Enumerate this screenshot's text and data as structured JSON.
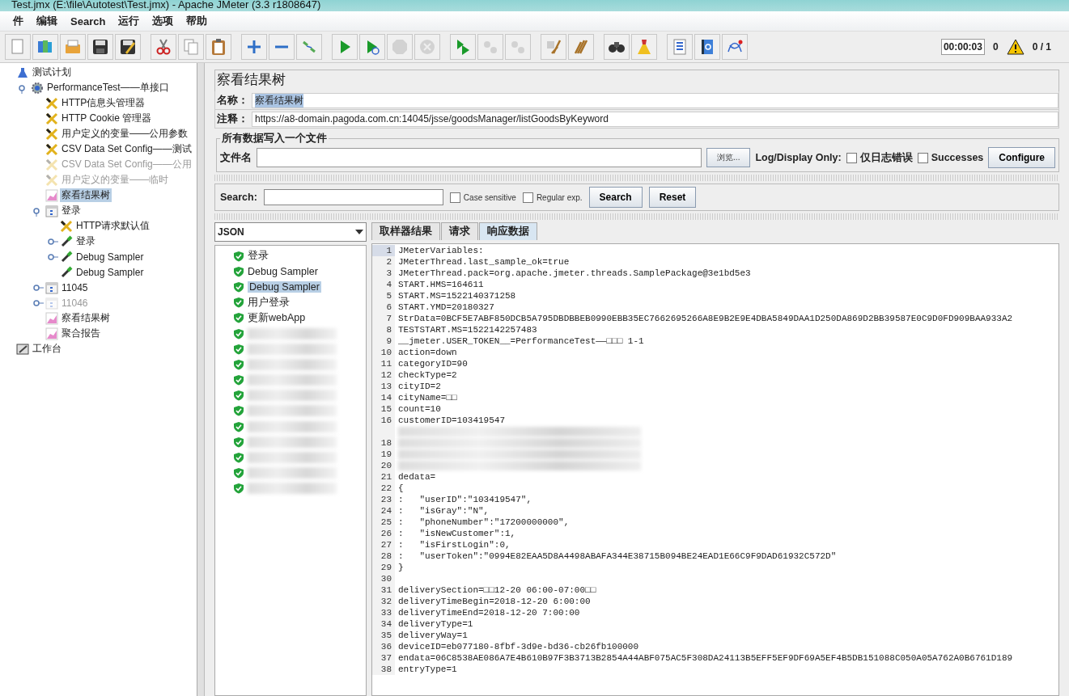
{
  "window": {
    "title": "Test.jmx (E:\\file\\Autotest\\Test.jmx) - Apache JMeter (3.3 r1808647)"
  },
  "menu": [
    "件",
    "编辑",
    "Search",
    "运行",
    "选项",
    "帮助"
  ],
  "toolbar": [
    {
      "kind": "new",
      "disabled": false
    },
    {
      "kind": "templates",
      "disabled": false
    },
    {
      "kind": "open",
      "disabled": false
    },
    {
      "kind": "save",
      "disabled": false
    },
    {
      "kind": "saveas",
      "disabled": false
    },
    {
      "kind": "sep"
    },
    {
      "kind": "cut",
      "disabled": false
    },
    {
      "kind": "copy",
      "disabled": false
    },
    {
      "kind": "paste",
      "disabled": false
    },
    {
      "kind": "sep"
    },
    {
      "kind": "expand",
      "disabled": false
    },
    {
      "kind": "collapse",
      "disabled": false
    },
    {
      "kind": "toggle",
      "disabled": false
    },
    {
      "kind": "sep"
    },
    {
      "kind": "start",
      "disabled": false
    },
    {
      "kind": "startnopause",
      "disabled": false
    },
    {
      "kind": "stop",
      "disabled": true
    },
    {
      "kind": "shutdown",
      "disabled": true
    },
    {
      "kind": "sep"
    },
    {
      "kind": "remotestart",
      "disabled": false
    },
    {
      "kind": "remotestop",
      "disabled": true
    },
    {
      "kind": "remoteshutdown",
      "disabled": true
    },
    {
      "kind": "sep"
    },
    {
      "kind": "clear",
      "disabled": false
    },
    {
      "kind": "clearall",
      "disabled": false
    },
    {
      "kind": "sep"
    },
    {
      "kind": "search",
      "disabled": false
    },
    {
      "kind": "reset",
      "disabled": false
    },
    {
      "kind": "sep"
    },
    {
      "kind": "functions",
      "disabled": false
    },
    {
      "kind": "help",
      "disabled": false
    },
    {
      "kind": "logger",
      "disabled": false
    }
  ],
  "status": {
    "timer": "00:00:03",
    "warnings": "0",
    "threads": "0 / 1"
  },
  "tree": [
    {
      "label": "测试计划",
      "kind": "plan",
      "selected": false,
      "disabled": false,
      "children": [
        {
          "label": "PerformanceTest——单接口",
          "kind": "threadgroup",
          "selected": false,
          "disabled": false,
          "expanded": true,
          "children": [
            {
              "label": "HTTP信息头管理器",
              "kind": "config",
              "selected": false,
              "disabled": false
            },
            {
              "label": "HTTP Cookie 管理器",
              "kind": "config",
              "selected": false,
              "disabled": false
            },
            {
              "label": "用户定义的变量——公用参数",
              "kind": "config",
              "selected": false,
              "disabled": false
            },
            {
              "label": "CSV Data Set Config——测试",
              "kind": "config",
              "selected": false,
              "disabled": false
            },
            {
              "label": "CSV Data Set Config——公用",
              "kind": "config",
              "selected": false,
              "disabled": true
            },
            {
              "label": "用户定义的变量——临时",
              "kind": "config",
              "selected": false,
              "disabled": true
            },
            {
              "label": "察看结果树",
              "kind": "listener",
              "selected": true,
              "disabled": false
            },
            {
              "label": "登录",
              "kind": "controller",
              "selected": false,
              "disabled": false,
              "expanded": true,
              "children": [
                {
                  "label": "HTTP请求默认值",
                  "kind": "config",
                  "selected": false,
                  "disabled": false
                },
                {
                  "label": "登录",
                  "kind": "sampler",
                  "selected": false,
                  "disabled": false,
                  "expanded": false
                },
                {
                  "label": "Debug Sampler",
                  "kind": "sampler",
                  "selected": false,
                  "disabled": false,
                  "expanded": false
                },
                {
                  "label": "Debug Sampler",
                  "kind": "sampler",
                  "selected": false,
                  "disabled": false
                }
              ]
            },
            {
              "label": "11045",
              "kind": "controller",
              "selected": false,
              "disabled": false,
              "expanded": false
            },
            {
              "label": "11046",
              "kind": "controller",
              "selected": false,
              "disabled": true,
              "expanded": false
            },
            {
              "label": "察看结果树",
              "kind": "listener",
              "selected": false,
              "disabled": false
            },
            {
              "label": "聚合报告",
              "kind": "listener",
              "selected": false,
              "disabled": false
            }
          ]
        }
      ]
    },
    {
      "label": "工作台",
      "kind": "workbench",
      "selected": false,
      "disabled": false
    }
  ],
  "panel": {
    "title": "察看结果树",
    "name_label": "名称：",
    "name_value": "察看结果树",
    "comment_label": "注释：",
    "comment_value": "https://a8-domain.pagoda.com.cn:14045/jsse/goodsManager/listGoodsByKeyword",
    "file_group": "所有数据写入一个文件",
    "file_label": "文件名",
    "browse": "浏览...",
    "log_label": "Log/Display Only:",
    "log_options": [
      {
        "label": "仅日志错误",
        "checked": false
      },
      {
        "label": "Successes",
        "checked": false
      }
    ],
    "configure": "Configure"
  },
  "search": {
    "label": "Search:",
    "options": [
      {
        "label": "Case sensitive",
        "checked": false
      },
      {
        "label": "Regular exp.",
        "checked": false
      }
    ],
    "buttons": [
      "Search",
      "Reset"
    ]
  },
  "renderer": "JSON",
  "results": [
    {
      "label": "登录",
      "selected": false
    },
    {
      "label": "Debug Sampler",
      "selected": false
    },
    {
      "label": "Debug Sampler",
      "selected": true
    },
    {
      "label": "用户登录",
      "selected": false
    },
    {
      "label": "更新webApp",
      "selected": false
    },
    {
      "kind": "blurred"
    },
    {
      "kind": "blurred"
    },
    {
      "kind": "blurred"
    },
    {
      "kind": "blurred"
    },
    {
      "kind": "blurred"
    },
    {
      "kind": "blurred"
    },
    {
      "kind": "blurred"
    },
    {
      "kind": "blurred"
    },
    {
      "kind": "blurred"
    },
    {
      "kind": "blurred"
    },
    {
      "kind": "blurred"
    }
  ],
  "tabs": [
    {
      "label": "取样器结果",
      "selected": false
    },
    {
      "label": "请求",
      "selected": false
    },
    {
      "label": "响应数据",
      "selected": true
    }
  ],
  "code": [
    {
      "num": "1",
      "text": "JMeterVariables:"
    },
    {
      "num": "2",
      "text": "JMeterThread.last_sample_ok=true"
    },
    {
      "num": "3",
      "text": "JMeterThread.pack=org.apache.jmeter.threads.SamplePackage@3e1bd5e3"
    },
    {
      "num": "4",
      "text": "START.HMS=164611"
    },
    {
      "num": "5",
      "text": "START.MS=1522140371258"
    },
    {
      "num": "6",
      "text": "START.YMD=20180327"
    },
    {
      "num": "7",
      "text": "StrData=0BCF5E7ABF850DCB5A795DBDBBEB0990EBB35EC7662695266A8E9B2E9E4DBA5849DAA1D250DA869D2BB39587E0C9D0FD909BAA933A2"
    },
    {
      "num": "8",
      "text": "TESTSTART.MS=1522142257483"
    },
    {
      "num": "9",
      "text": "__jmeter.USER_TOKEN__=PerformanceTest——□□□ 1-1"
    },
    {
      "num": "10",
      "text": "action=down"
    },
    {
      "num": "11",
      "text": "categoryID=90"
    },
    {
      "num": "12",
      "text": "checkType=2"
    },
    {
      "num": "13",
      "text": "cityID=2"
    },
    {
      "num": "14",
      "text": "cityName=□□"
    },
    {
      "num": "15",
      "text": "count=10"
    },
    {
      "num": "16",
      "text": "customerID=103419547"
    },
    {
      "kind": "blurred"
    },
    {
      "num": "18",
      "kind": "blurred"
    },
    {
      "num": "19",
      "kind": "blurred"
    },
    {
      "num": "20",
      "kind": "blurred"
    },
    {
      "num": "21",
      "text": "dedata="
    },
    {
      "num": "22",
      "text": "{"
    },
    {
      "num": "23",
      "text": ":   \"userID\":\"103419547\","
    },
    {
      "num": "24",
      "text": ":   \"isGray\":\"N\","
    },
    {
      "num": "25",
      "text": ":   \"phoneNumber\":\"17200000000\","
    },
    {
      "num": "26",
      "text": ":   \"isNewCustomer\":1,"
    },
    {
      "num": "27",
      "text": ":   \"isFirstLogin\":0,"
    },
    {
      "num": "28",
      "text": ":   \"userToken\":\"0994E82EAA5D8A4498ABAFA344E38715B094BE24EAD1E66C9F9DAD61932C572D\""
    },
    {
      "num": "29",
      "text": "}"
    },
    {
      "num": "30"
    },
    {
      "num": "31",
      "text": "deliverySection=□□12-20 06:00-07:00□□"
    },
    {
      "num": "32",
      "text": "deliveryTimeBegin=2018-12-20 6:00:00"
    },
    {
      "num": "33",
      "text": "deliveryTimeEnd=2018-12-20 7:00:00"
    },
    {
      "num": "34",
      "text": "deliveryType=1"
    },
    {
      "num": "35",
      "text": "deliveryWay=1"
    },
    {
      "num": "36",
      "text": "deviceID=eb077180-8fbf-3d9e-bd36-cb26fb100000"
    },
    {
      "num": "37",
      "text": "endata=06C8538AE086A7E4B610B97F3B3713B2854A44ABF075AC5F308DA24113B5EFF5EF9DF69A5EF4B5DB151088C050A05A762A0B6761D189"
    },
    {
      "num": "38",
      "text": "entryType=1"
    }
  ]
}
